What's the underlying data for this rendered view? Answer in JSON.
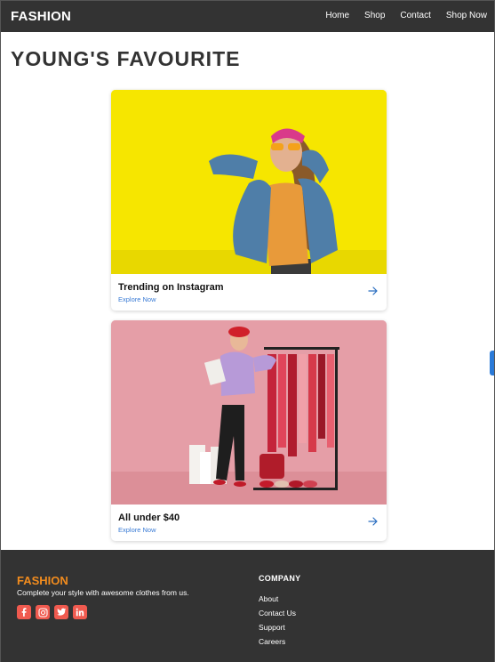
{
  "navbar": {
    "brand": "FASHION",
    "links": [
      "Home",
      "Shop",
      "Contact",
      "Shop Now"
    ]
  },
  "page": {
    "title": "YOUNG'S FAVOURITE"
  },
  "cards": [
    {
      "title": "Trending on Instagram",
      "link": "Explore Now",
      "icon": "arrow-right-icon",
      "image": "woman-in-denim-jacket-yellow-background"
    },
    {
      "title": "All under $40",
      "link": "Explore Now",
      "icon": "arrow-right-icon",
      "image": "woman-with-clothes-rack-pink-background"
    }
  ],
  "footer": {
    "brand": "FASHION",
    "tagline": "Complete your style with awesome clothes from us.",
    "social_icons": [
      "facebook-icon",
      "instagram-icon",
      "twitter-icon",
      "linkedin-icon"
    ],
    "company_heading": "COMPANY",
    "company_links": [
      "About",
      "Contact Us",
      "Support",
      "Careers"
    ]
  },
  "colors": {
    "navbar": "#333333",
    "footer_brand": "#f28c1e",
    "social": "#f05a4f",
    "link": "#3a7bd5"
  }
}
